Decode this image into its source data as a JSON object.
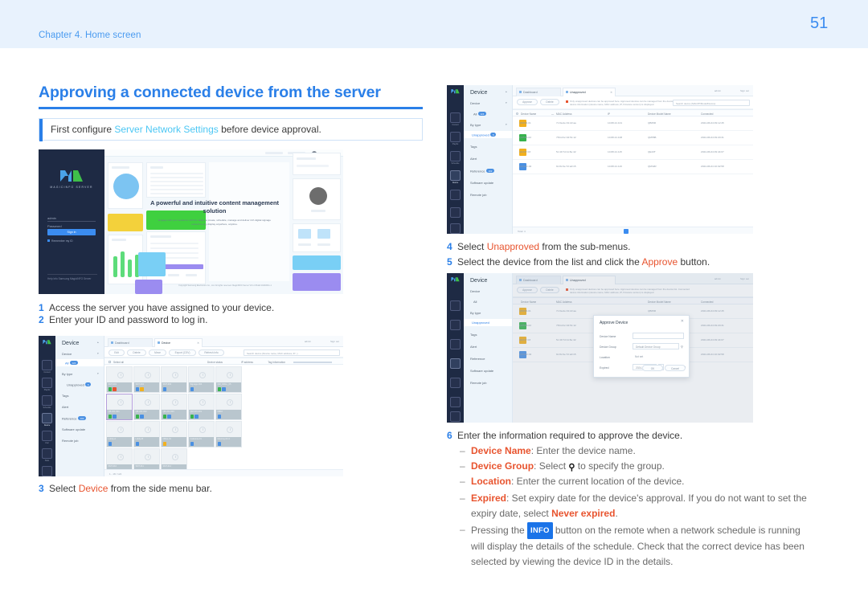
{
  "header": {
    "chapter": "Chapter 4. Home screen",
    "page_number": "51"
  },
  "title": "Approving a connected device from the server",
  "note": {
    "prefix": "First configure ",
    "link": "Server Network Settings",
    "suffix": " before device approval.",
    "accent_color": "#2a7fe8",
    "link_color": "#4cc7f4"
  },
  "steps": {
    "s1": {
      "num": "1",
      "text": "Access the server you have assigned to your device."
    },
    "s2": {
      "num": "2",
      "text": "Enter your ID and password to log in."
    },
    "s3": {
      "num": "3",
      "pre": "Select ",
      "hl": "Device",
      "post": " from the side menu bar."
    },
    "s4": {
      "num": "4",
      "pre": "Select ",
      "hl": "Unapproved",
      "post": " from the sub-menus."
    },
    "s5": {
      "num": "5",
      "pre": "Select the device from the list and click the ",
      "hl": "Approve",
      "post": " button."
    },
    "s6": {
      "num": "6",
      "text": "Enter the information required to approve the device."
    }
  },
  "bullets": [
    {
      "label": "Device Name",
      "text": ": Enter the device name."
    },
    {
      "label": "Device Group",
      "text": ": Select ",
      "icon": "search-icon",
      "text2": " to specify the group."
    },
    {
      "label": "Location",
      "text": ": Enter the current location of the device."
    },
    {
      "label": "Expired",
      "text": ": Set expiry date for the device's approval. If you do not want to set the expiry date, select ",
      "hl": "Never expired",
      "text2": "."
    },
    {
      "pre": "Pressing the ",
      "badge": "INFO",
      "text": " button on the remote when a network schedule is running will display the details of the schedule. Check that the correct device has been selected by viewing the device ID in the details."
    }
  ],
  "shot_login": {
    "logo_text": "MAGICINFO SERVER",
    "id_value": "admin",
    "password_placeholder": "Password",
    "signin_label": "Sign in",
    "remember_label": "Remember my ID",
    "footer": "Help Info\nSamsung MagicINFO Server",
    "hero_title": "A powerful and intuitive content management solution",
    "hero_sub": "Engage with your audience with the ability to create, schedule, manage and deliver rich digital signage content to any display anywhere, anytime.",
    "credit": "Copyright Samsung Electronics Co., Ltd. All rights reserved.\nMagicINFO Server V9.1.0 Build 20240611-1"
  },
  "shot_device_grid": {
    "panel_title": "Device",
    "panel_items": [
      {
        "label": "Device",
        "chev": true
      },
      {
        "label": "All",
        "pill": "124"
      },
      {
        "label": "By type",
        "chev": true
      },
      {
        "label": "Unapproved",
        "pill": "8",
        "selected": true
      },
      {
        "label": "Tags"
      },
      {
        "label": "Alert"
      },
      {
        "label": "Reference",
        "pill": "102"
      },
      {
        "label": "Software update"
      },
      {
        "label": "Remote job"
      }
    ],
    "tabs": [
      {
        "label": "Dashboard",
        "active": false
      },
      {
        "label": "Device",
        "active": true
      }
    ],
    "toolbar_buttons": [
      "Edit",
      "Delete",
      "Move",
      "Export (CSV)",
      "Refresh Info"
    ],
    "select_all_label": "Select all",
    "search_placeholder": "Search device (Device name, MAC address, IP...)",
    "view_options": [
      "Device status",
      "IP address",
      "Tag information"
    ],
    "devices": [
      {
        "name": "SMT-001",
        "chips": [
          "#37b24d",
          "#e8542f"
        ]
      },
      {
        "name": "SMT-002",
        "chips": [
          "#4a90e2",
          "#f2b01e"
        ]
      },
      {
        "name": "SMT-003",
        "chips": [
          "#4a90e2"
        ]
      },
      {
        "name": "Signage-004",
        "chips": [
          "#4a90e2"
        ]
      },
      {
        "name": "QM_WALL_05",
        "chips": [
          "#37b24d",
          "#4a90e2"
        ]
      },
      {
        "name": "QB-221-001",
        "chips": [
          "#37b24d",
          "#4a90e2"
        ],
        "highlight": true
      },
      {
        "name": "QB-221-002",
        "chips": [
          "#37b24d",
          "#4a90e2"
        ]
      },
      {
        "name": "QB-221-003",
        "chips": [
          "#37b24d",
          "#4a90e2"
        ]
      },
      {
        "name": "QM-331-001",
        "chips": [
          "#37b24d",
          "#4a90e2"
        ]
      },
      {
        "name": "DB10",
        "chips": [
          "#4a90e2"
        ]
      },
      {
        "name": "Lobby-A",
        "chips": [
          "#4a90e2"
        ]
      },
      {
        "name": "Lobby-B",
        "chips": [
          "#4a90e2"
        ]
      },
      {
        "name": "Office-01",
        "chips": [
          "#f2b01e"
        ]
      },
      {
        "name": "Cafeteria-01",
        "chips": [
          "#4a90e2"
        ]
      },
      {
        "name": "Meeting-Rm1",
        "chips": [
          "#4a90e2"
        ]
      },
      {
        "name": "SMT-010",
        "chips": [
          "#37b24d",
          "#4a90e2"
        ]
      },
      {
        "name": "SMT-011",
        "chips": [
          "#37b24d",
          "#4a90e2"
        ]
      },
      {
        "name": "SMT-012",
        "chips": [
          "#37b24d",
          "#4a90e2"
        ]
      }
    ]
  },
  "shot_unapproved": {
    "panel_title": "Device",
    "panel_items": [
      {
        "label": "Device",
        "chev": true
      },
      {
        "label": "All",
        "pill": "124"
      },
      {
        "label": "By type",
        "chev": true
      },
      {
        "label": "Unapproved",
        "pill": "8",
        "selected": true
      },
      {
        "label": "Tags"
      },
      {
        "label": "Alert"
      },
      {
        "label": "Reference",
        "pill": "102"
      },
      {
        "label": "Software update"
      },
      {
        "label": "Remote job"
      }
    ],
    "tabs": [
      {
        "label": "Dashboard",
        "active": false
      },
      {
        "label": "Unapproved",
        "active": true
      }
    ],
    "toolbar_buttons": [
      "Approve",
      "Delete"
    ],
    "warning": "Only unapproved devices can be approved here. Approved devices can be managed from the device list. Connected device information (device name, MAC address, IP, firmware version) is displayed.",
    "search_placeholder": "Search device (MAC/IP/Model/Device)",
    "columns": [
      "Device Name",
      "MAC Address",
      "IP",
      "Device Model Name",
      "Connected"
    ],
    "rows": [
      {
        "name": "QB65R-01",
        "mac": "7c:0a:de:01:22:aa",
        "ip": "10.88.21.101",
        "model": "QB65R",
        "connected": "2024-06-04 09:12:45",
        "chip": "#f2b01e"
      },
      {
        "name": "QM55B-02",
        "mac": "78:bd:bc:04:51:12",
        "ip": "10.88.21.108",
        "model": "QM55B",
        "connected": "2024-06-04 09:20:31",
        "chip": "#37b24d"
      },
      {
        "name": "QE43T-03",
        "mac": "5c:49:7d:11:8e:42",
        "ip": "10.88.21.115",
        "model": "QE43T",
        "connected": "2024-06-04 09:44:07",
        "chip": "#f2b01e"
      },
      {
        "name": "QM32R-04",
        "mac": "9c:8c:6e:72:a0:15",
        "ip": "10.88.21.119",
        "model": "QM32R",
        "connected": "2024-06-04 10:02:58",
        "chip": "#4a90e2"
      }
    ],
    "total_label": "Total: 4"
  },
  "shot_approve_dialog": {
    "dialog_title": "Approve Device",
    "close_icon": "close-icon",
    "fields": [
      {
        "label": "Device Name",
        "value": ""
      },
      {
        "label": "Device Group",
        "value": "Default Device Group",
        "icon": "search-icon"
      },
      {
        "label": "Location",
        "value": "Not set"
      },
      {
        "label": "Expired",
        "value": "2024-12-31"
      }
    ],
    "never_expired_label": "never expired",
    "ok_label": "OK",
    "cancel_label": "Cancel"
  }
}
